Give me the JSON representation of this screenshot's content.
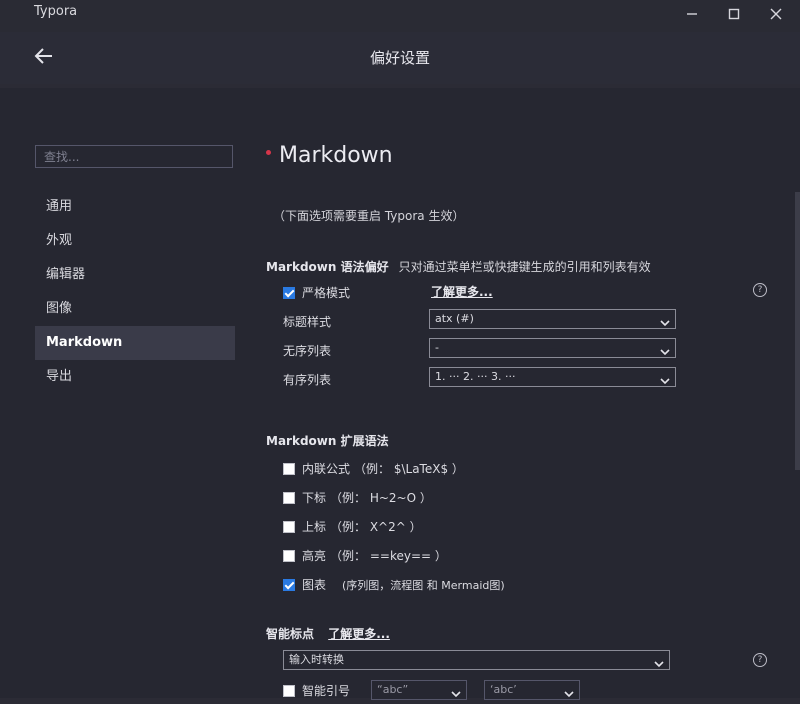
{
  "window": {
    "app_title": "Typora"
  },
  "header": {
    "title": "偏好设置"
  },
  "search": {
    "placeholder": "查找..."
  },
  "nav": {
    "items": [
      "通用",
      "外观",
      "编辑器",
      "图像",
      "Markdown",
      "导出"
    ],
    "active": "Markdown"
  },
  "section": {
    "title": "Markdown",
    "note": "（下面选项需要重启 Typora 生效）"
  },
  "syntax_pref": {
    "heading": "Markdown 语法偏好",
    "subtitle": "只对通过菜单栏或快捷键生成的引用和列表有效",
    "strict_mode": {
      "label": "严格模式",
      "checked": true
    },
    "learn_more": "了解更多...",
    "heading_style": {
      "label": "标题样式",
      "value": "atx (#)"
    },
    "unordered_list": {
      "label": "无序列表",
      "value": "-"
    },
    "ordered_list": {
      "label": "有序列表",
      "value": "1. ··· 2. ··· 3. ···"
    }
  },
  "extended": {
    "heading": "Markdown 扩展语法",
    "items": [
      {
        "label": "内联公式",
        "example": "（例： $\\LaTeX$ ）",
        "checked": false
      },
      {
        "label": "下标",
        "example": "（例： H~2~O ）",
        "checked": false
      },
      {
        "label": "上标",
        "example": "（例： X^2^ ）",
        "checked": false
      },
      {
        "label": "高亮",
        "example": "（例： ==key== ）",
        "checked": false
      },
      {
        "label": "图表",
        "example": "(序列图，流程图 和 Mermaid图)",
        "checked": true
      }
    ]
  },
  "smart_punct": {
    "heading": "智能标点",
    "learn_more": "了解更多...",
    "mode": "输入时转换",
    "smart_quotes": {
      "label": "智能引号",
      "checked": false,
      "double": "“abc”",
      "single": "‘abc’"
    }
  },
  "colors": {
    "accent_dot": "#d6354a",
    "checkbox_checked": "#2a7ae2"
  }
}
